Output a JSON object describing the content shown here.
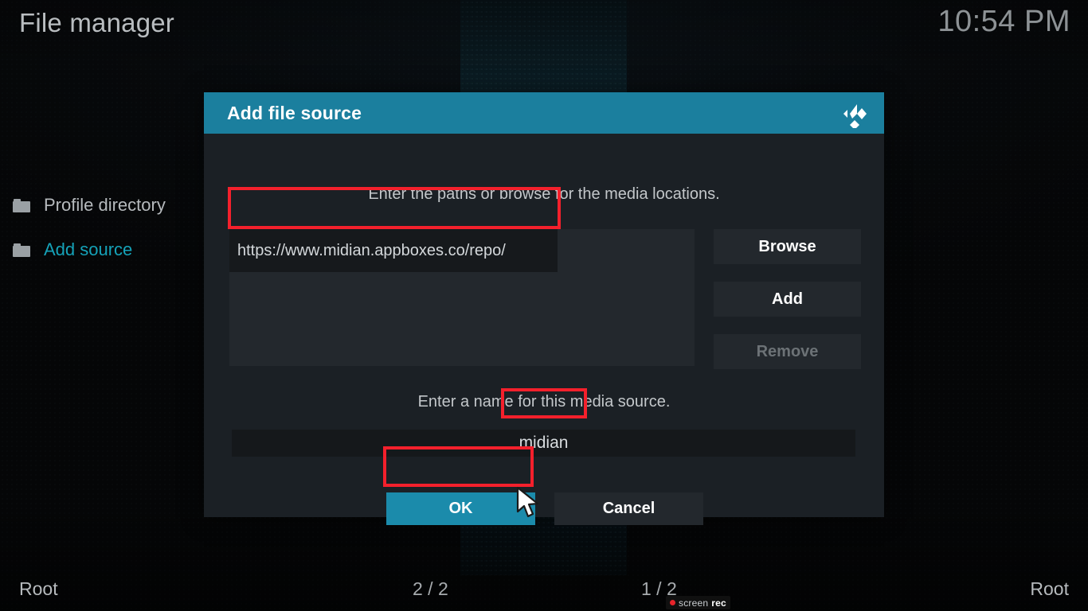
{
  "header": {
    "title": "File manager",
    "clock": "10:54 PM"
  },
  "sidebar": {
    "items": [
      {
        "label": "Profile directory",
        "icon": "folder-icon",
        "selected": false
      },
      {
        "label": "Add source",
        "icon": "folder-icon",
        "selected": true
      }
    ]
  },
  "dialog": {
    "title": "Add file source",
    "logo_icon": "kodi-logo-icon",
    "paths_hint": "Enter the paths or browse for the media locations.",
    "path_entries": [
      "https://www.midian.appboxes.co/repo/"
    ],
    "buttons": {
      "browse": "Browse",
      "add": "Add",
      "remove": "Remove"
    },
    "name_hint": "Enter a name for this media source.",
    "name_value": "midian",
    "ok": "OK",
    "cancel": "Cancel"
  },
  "statusbar": {
    "left_path": "Root",
    "left_count": "2 / 2",
    "right_count": "1 / 2",
    "right_path": "Root"
  },
  "watermark": {
    "screen": "screen",
    "rec": "rec"
  },
  "colors": {
    "accent": "#1b7f9e",
    "accent_button": "#1b8bab",
    "selected_text": "#15a2b8",
    "annotation": "#f4202c",
    "dialog_bg": "#1b2025",
    "control_bg": "#23282d"
  }
}
